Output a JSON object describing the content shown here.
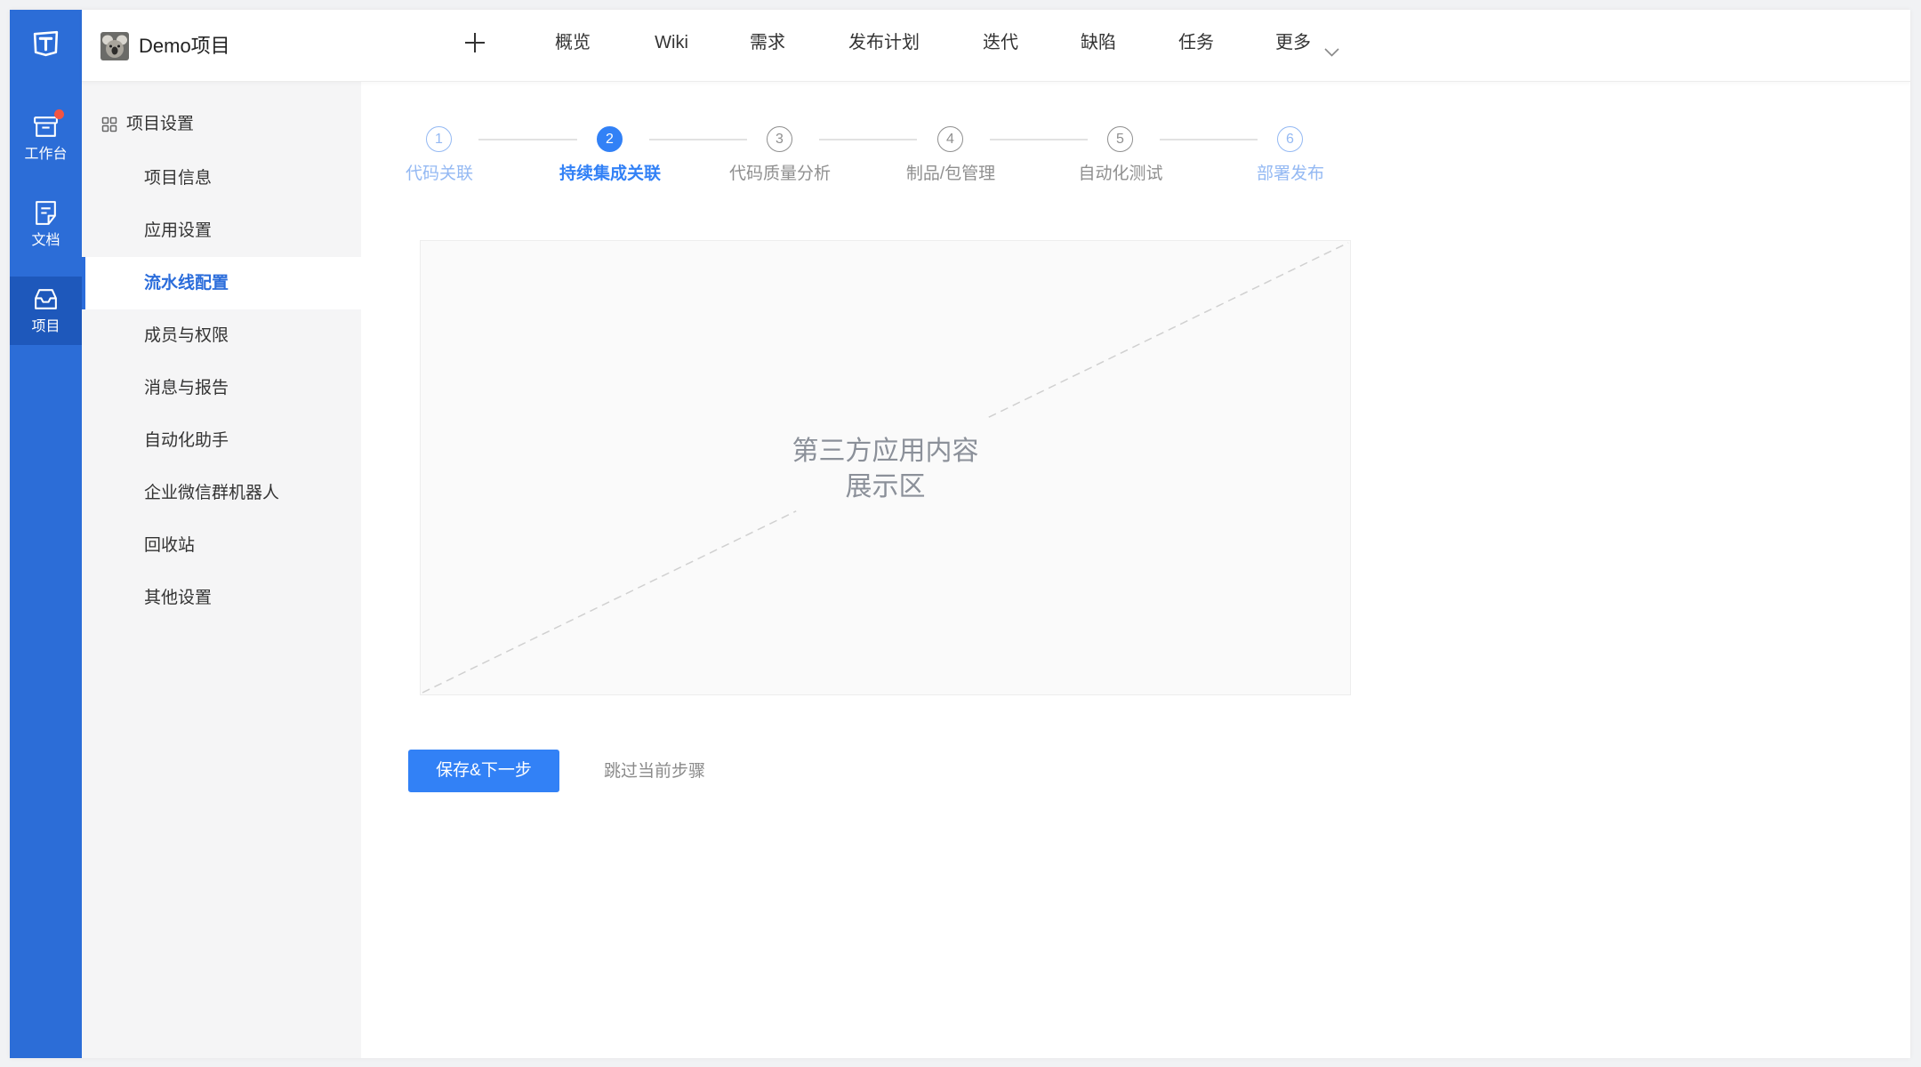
{
  "theme": {
    "rail_bg": "#2c6dd7",
    "rail_active_bg": "#1e58bb",
    "accent": "#3281f6",
    "sidebar_active": "#2b6ddb",
    "badge": "#f35442"
  },
  "rail": {
    "logo_icon": "app-logo-icon",
    "items": [
      {
        "label": "工作台",
        "icon": "workbench-icon",
        "badge_dot": true,
        "active": false
      },
      {
        "label": "文档",
        "icon": "document-icon",
        "badge_dot": false,
        "active": false
      },
      {
        "label": "项目",
        "icon": "project-icon",
        "badge_dot": false,
        "active": true
      }
    ]
  },
  "header": {
    "project_name": "Demo项目",
    "avatar_icon": "project-avatar",
    "add_icon": "plus-icon",
    "nav": [
      {
        "label": "概览"
      },
      {
        "label": "Wiki"
      },
      {
        "label": "需求"
      },
      {
        "label": "发布计划"
      },
      {
        "label": "迭代"
      },
      {
        "label": "缺陷"
      },
      {
        "label": "任务"
      },
      {
        "label": "更多",
        "icon": "chevron-down-icon"
      }
    ]
  },
  "sidebar": {
    "section_icon": "grid-icon",
    "section_title": "项目设置",
    "items": [
      {
        "label": "项目信息",
        "active": false
      },
      {
        "label": "应用设置",
        "active": false
      },
      {
        "label": "流水线配置",
        "active": true
      },
      {
        "label": "成员与权限",
        "active": false
      },
      {
        "label": "消息与报告",
        "active": false
      },
      {
        "label": "自动化助手",
        "active": false
      },
      {
        "label": "企业微信群机器人",
        "active": false
      },
      {
        "label": "回收站",
        "active": false
      },
      {
        "label": "其他设置",
        "active": false
      }
    ]
  },
  "wizard": {
    "current_step": 2,
    "steps": [
      {
        "number": 1,
        "label": "代码关联",
        "color": "#94b9f3"
      },
      {
        "number": 2,
        "label": "持续集成关联",
        "color": "#3281f6"
      },
      {
        "number": 3,
        "label": "代码质量分析",
        "color": "#8f8f8f"
      },
      {
        "number": 4,
        "label": "制品/包管理",
        "color": "#8f8f8f"
      },
      {
        "number": 5,
        "label": "自动化测试",
        "color": "#8f8f8f"
      },
      {
        "number": 6,
        "label": "部署发布",
        "color": "#94b9f3"
      }
    ],
    "placeholder": {
      "line1": "第三方应用内容",
      "line2": "展示区"
    },
    "primary_button": "保存&下一步",
    "skip_link": "跳过当前步骤"
  }
}
